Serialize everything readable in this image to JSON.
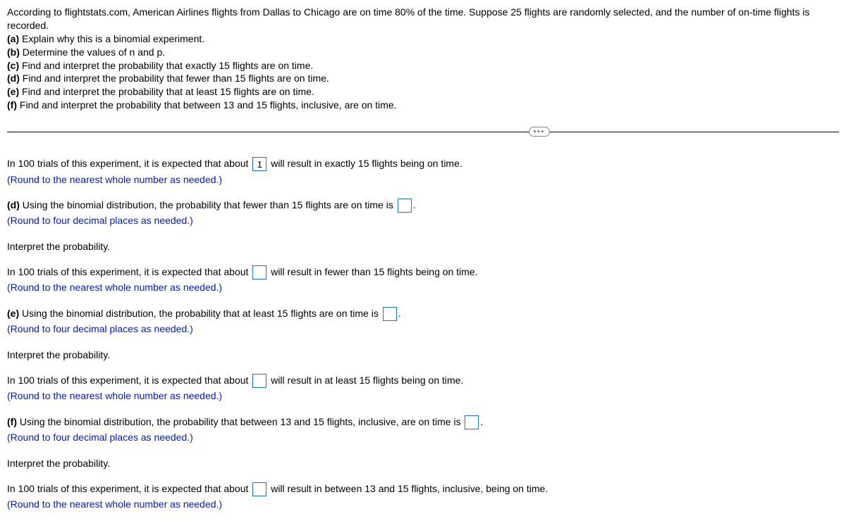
{
  "header": {
    "intro": "According to flightstats.com, American Airlines flights from Dallas to Chicago are on time 80% of the time. Suppose 25 flights are randomly selected, and the number of on-time flights is recorded.",
    "a_label": "(a)",
    "a_text": " Explain why this is a binomial experiment.",
    "b_label": "(b)",
    "b_text": " Determine the values of n and p.",
    "c_label": "(c)",
    "c_text": " Find and interpret the probability that exactly 15 flights are on time.",
    "d_label": "(d)",
    "d_text": " Find and interpret the probability that fewer than 15 flights are on time.",
    "e_label": "(e)",
    "e_text": " Find and interpret the probability that at least 15 flights are on time.",
    "f_label": "(f)",
    "f_text": " Find and interpret the probability that between 13 and 15 flights, inclusive, are on time."
  },
  "body": {
    "c_interpret": {
      "prefix": "In 100 trials of this experiment, it is expected that about ",
      "value": "1",
      "suffix": " will result in exactly 15 flights being on time.",
      "help": "(Round to the nearest whole number as needed.)"
    },
    "d": {
      "label": "(d)",
      "prefix": " Using the binomial distribution, the probability that fewer than 15 flights are on time is ",
      "suffix": ".",
      "help": "(Round to four decimal places as needed.)",
      "interpret_heading": "Interpret the probability.",
      "interpret_prefix": "In 100 trials of this experiment, it is expected that about ",
      "interpret_suffix": " will result in fewer than 15 flights being on time.",
      "interpret_help": "(Round to the nearest whole number as needed.)"
    },
    "e": {
      "label": "(e)",
      "prefix": " Using the binomial distribution, the probability that at least 15 flights are on time is ",
      "suffix": ".",
      "help": "(Round to four decimal places as needed.)",
      "interpret_heading": "Interpret the probability.",
      "interpret_prefix": "In 100 trials of this experiment, it is expected that about ",
      "interpret_suffix": " will result in at least 15 flights being on time.",
      "interpret_help": "(Round to the nearest whole number as needed.)"
    },
    "f": {
      "label": "(f)",
      "prefix": " Using the binomial distribution, the probability that between 13 and 15 flights, inclusive, are on time is ",
      "suffix": ".",
      "help": "(Round to four decimal places as needed.)",
      "interpret_heading": "Interpret the probability.",
      "interpret_prefix": "In 100 trials of this experiment, it is expected that about ",
      "interpret_suffix": " will result in between 13 and 15 flights, inclusive, being on time.",
      "interpret_help": "(Round to the nearest whole number as needed.)"
    }
  }
}
